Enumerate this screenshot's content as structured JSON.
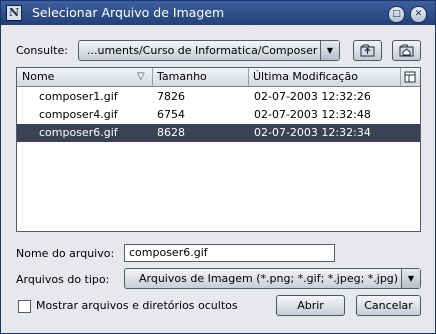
{
  "window": {
    "title": "Selecionar Arquivo de Imagem",
    "icon_letter": "N",
    "minimize_glyph": "□",
    "close_glyph": "✕"
  },
  "lookin": {
    "label": "Consulte:",
    "path": "...uments/Curso de Informatica/Composer",
    "arrow_glyph": "▼"
  },
  "toolbar": {
    "up_glyph": "⇧",
    "home_glyph": "⌂"
  },
  "list": {
    "columns": [
      "Nome",
      "Tamanho",
      "Última Modificação"
    ],
    "sort_glyph": "▽",
    "rows": [
      {
        "name": "composer1.gif",
        "size": "7826",
        "modified": "02-07-2003 12:32:26"
      },
      {
        "name": "composer4.gif",
        "size": "6754",
        "modified": "02-07-2003 12:32:48"
      },
      {
        "name": "composer6.gif",
        "size": "8628",
        "modified": "02-07-2003 12:32:34"
      }
    ],
    "selected_index": 2
  },
  "filename": {
    "label": "Nome do arquivo:",
    "value": "composer6.gif"
  },
  "filetype": {
    "label": "Arquivos do tipo:",
    "value": "Arquivos de Imagem (*.png; *.gif; *.jpeg; *.jpg)",
    "arrow_glyph": "▼"
  },
  "hidden_files": {
    "label": "Mostrar arquivos e diretórios ocultos",
    "checked": false
  },
  "buttons": {
    "open": "Abrir",
    "cancel": "Cancelar"
  },
  "colors": {
    "titlebar": "#2c4b87",
    "selection": "#3b4254",
    "dialog_bg": "#e6e8ec"
  }
}
